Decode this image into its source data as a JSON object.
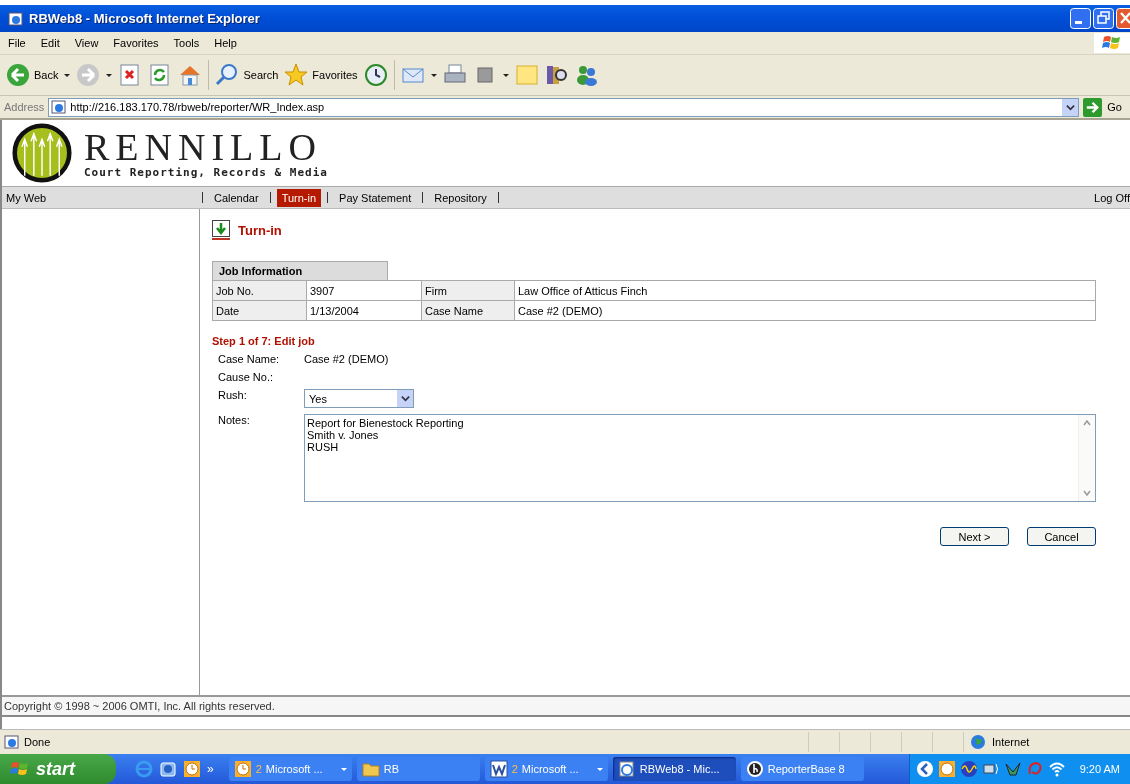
{
  "window": {
    "title": "RBWeb8 - Microsoft Internet Explorer"
  },
  "menu": [
    "File",
    "Edit",
    "View",
    "Favorites",
    "Tools",
    "Help"
  ],
  "toolbar": [
    {
      "kind": "back",
      "label": "Back",
      "dropdown": true
    },
    {
      "kind": "forward",
      "dropdown": true
    },
    {
      "kind": "stop"
    },
    {
      "kind": "refresh"
    },
    {
      "kind": "home"
    },
    {
      "kind": "search",
      "label": "Search"
    },
    {
      "kind": "favorites",
      "label": "Favorites"
    },
    {
      "kind": "history"
    },
    {
      "kind": "mail",
      "dropdown": true
    },
    {
      "kind": "print"
    },
    {
      "kind": "edit",
      "dropdown": true
    },
    {
      "kind": "note"
    },
    {
      "kind": "research"
    },
    {
      "kind": "messenger"
    }
  ],
  "address": {
    "label": "Address",
    "url": "http://216.183.170.78/rbweb/reporter/WR_Index.asp",
    "go": "Go"
  },
  "site": {
    "name": "RENNILLO",
    "tagline": "Court Reporting, Records & Media"
  },
  "nav": {
    "home": "My Web",
    "items": [
      {
        "label": "Calendar",
        "selected": false
      },
      {
        "label": "Turn-in",
        "selected": true
      },
      {
        "label": "Pay Statement",
        "selected": false
      },
      {
        "label": "Repository",
        "selected": false
      }
    ],
    "logoff": "Log Off"
  },
  "page_title": "Turn-in",
  "job_info": {
    "heading": "Job Information",
    "rows": [
      [
        "Job No.",
        "3907",
        "Firm",
        "Law Office of Atticus Finch"
      ],
      [
        "Date",
        "1/13/2004",
        "Case Name",
        "Case #2 (DEMO)"
      ]
    ]
  },
  "step": "Step 1 of 7: Edit job",
  "form": {
    "case_name": {
      "label": "Case Name:",
      "value": "Case #2 (DEMO)"
    },
    "cause_no": {
      "label": "Cause No.:"
    },
    "rush": {
      "label": "Rush:",
      "value": "Yes"
    },
    "notes": {
      "label": "Notes:",
      "value": "Report for Bienestock Reporting\nSmith v. Jones\nRUSH"
    }
  },
  "buttons": [
    "Next >",
    "Cancel"
  ],
  "copyright": "Copyright © 1998 ~ 2006 OMTI, Inc. All rights reserved.",
  "status_bar": {
    "text": "Done",
    "zone": "Internet"
  },
  "taskbar": {
    "start": "start",
    "overflow": "»",
    "tasks": [
      {
        "kind": "clock",
        "count": "2",
        "label": "Microsoft ...",
        "group": true,
        "selected": false
      },
      {
        "kind": "folder",
        "label": "RB",
        "selected": false
      },
      {
        "kind": "word",
        "count": "2",
        "label": "Microsoft ...",
        "group": true,
        "selected": false
      },
      {
        "kind": "ie",
        "label": "RBWeb8 - Mic...",
        "selected": true
      },
      {
        "kind": "b",
        "label": "ReporterBase 8",
        "selected": false
      }
    ],
    "time": "9:20 AM"
  }
}
